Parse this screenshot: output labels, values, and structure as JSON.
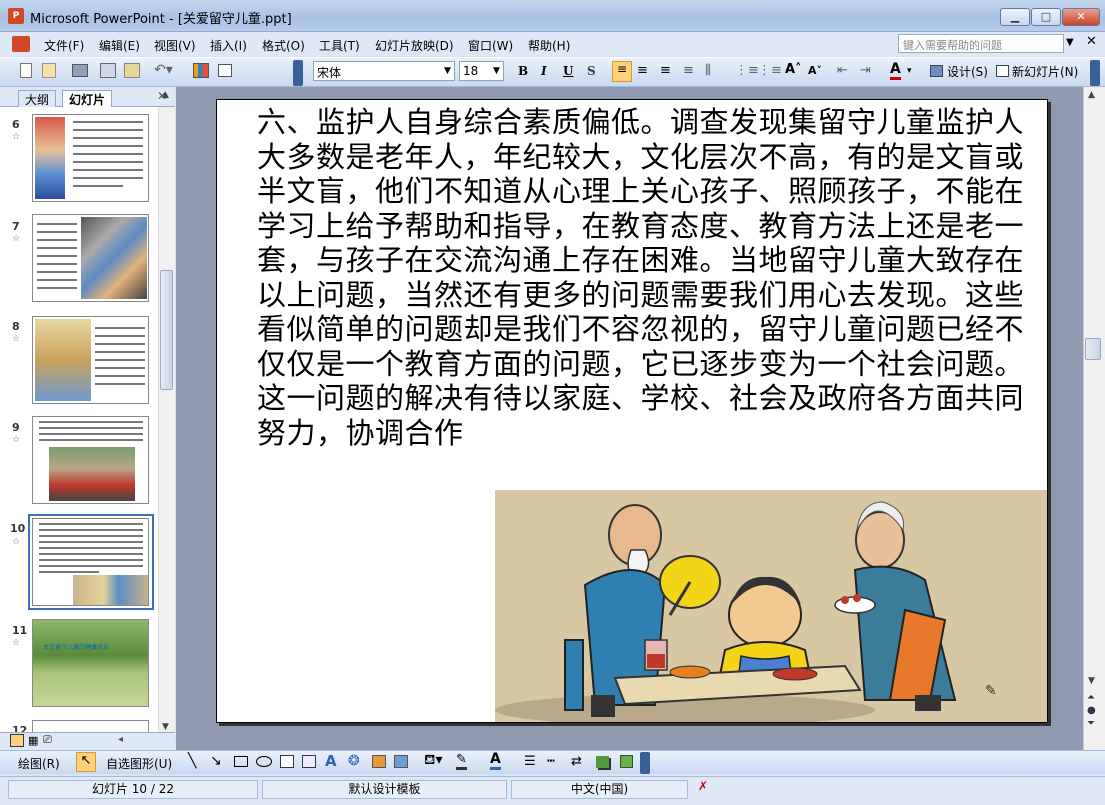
{
  "window": {
    "title": "Microsoft PowerPoint - [关爱留守儿童.ppt]"
  },
  "menu": [
    "文件(F)",
    "编辑(E)",
    "视图(V)",
    "插入(I)",
    "格式(O)",
    "工具(T)",
    "幻灯片放映(D)",
    "窗口(W)",
    "帮助(H)"
  ],
  "help_placeholder": "键入需要帮助的问题",
  "toolbar": {
    "font": "宋体",
    "size": "18",
    "bold": "B",
    "italic": "I",
    "underline": "U",
    "shadow": "S",
    "design": "设计(S)",
    "new_slide": "新幻灯片(N)"
  },
  "panel_tabs": {
    "outline": "大纲",
    "slides": "幻灯片"
  },
  "thumbnails": [
    {
      "num": "6"
    },
    {
      "num": "7"
    },
    {
      "num": "8"
    },
    {
      "num": "9"
    },
    {
      "num": "10"
    },
    {
      "num": "11"
    },
    {
      "num": "12"
    }
  ],
  "thumb11_caption": "关注留守儿童的健康成长",
  "slide": {
    "text": "六、监护人自身综合素质偏低。调查发现集留守儿童监护人大多数是老年人，年纪较大，文化层次不高，有的是文盲或半文盲，他们不知道从心理上关心孩子、照顾孩子，不能在学习上给予帮助和指导，在教育态度、教育方法上还是老一套，与孩子在交流沟通上存在困难。当地留守儿童大致存在以上问题，当然还有更多的问题需要我们用心去发现。这些看似简单的问题却是我们不容忽视的，留守儿童问题已经不仅仅是一个教育方面的问题，它已逐步变为一个社会问题。这一问题的解决有待以家庭、学校、社会及政府各方面共同努力，协调合作"
  },
  "drawbar": {
    "draw": "绘图(R)",
    "autoshapes": "自选图形(U)"
  },
  "status": {
    "slide": "幻灯片 10 / 22",
    "template": "默认设计模板",
    "language": "中文(中国)"
  },
  "colors": {
    "accent": "#3b6fb6",
    "chrome": "#dfe8f6",
    "workspace": "#8f9ab0"
  }
}
